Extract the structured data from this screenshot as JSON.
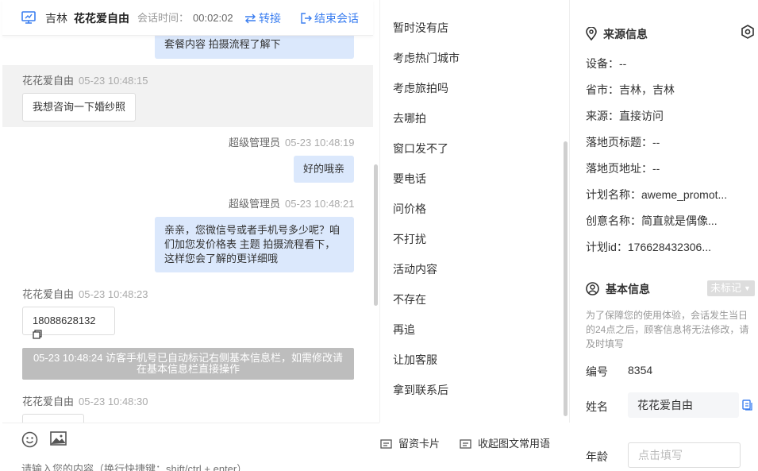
{
  "header": {
    "city": "吉林",
    "customer_name": "花花爱自由",
    "session_time_label": "会话时间：",
    "session_time": "00:02:02",
    "transfer_label": "转接",
    "end_label": "结束会话"
  },
  "messages": {
    "m0": {
      "text": "套餐内容 拍摄流程了解下"
    },
    "m1": {
      "sender": "花花爱自由",
      "time": "05-23 10:48:15",
      "text": "我想咨询一下婚纱照"
    },
    "m2": {
      "sender": "超级管理员",
      "time": "05-23 10:48:19",
      "text": "好的哦亲"
    },
    "m3": {
      "sender": "超级管理员",
      "time": "05-23 10:48:21",
      "line1": "亲亲，您微信号或者手机号多少呢？咱",
      "line2": "们加您发价格表 主题 拍摄流程看下，",
      "line3": "这样您会了解的更详细哦"
    },
    "m4": {
      "sender": "花花爱自由",
      "time": "05-23 10:48:23",
      "text": "18088628132"
    },
    "system": {
      "line1": "05-23 10:48:24 访客手机号已自动标记右侧基本信息栏，如需修改请",
      "line2": "在基本信息栏直接操作"
    },
    "m5": {
      "sender": "花花爱自由",
      "time": "05-23 10:48:30"
    }
  },
  "composer": {
    "card_label": "留资卡片",
    "phrases_label": "收起图文常用语",
    "placeholder": "请输入您的内容（换行快捷键：shift/ctrl + enter）"
  },
  "quick_replies": [
    "暂时没有店",
    "考虑热门城市",
    "考虑旅拍吗",
    "去哪拍",
    "窗口发不了",
    "要电话",
    "问价格",
    "不打扰",
    "活动内容",
    "不存在",
    "再追",
    "让加客服",
    "拿到联系后"
  ],
  "source_info": {
    "title": "来源信息",
    "device": "设备：--",
    "province_city": "省市：吉林，吉林",
    "source": "来源：直接访问",
    "landing_title": "落地页标题：--",
    "landing_url": "落地页地址：--",
    "plan_name": "计划名称：aweme_promot...",
    "creative_name": "创意名称：简直就是偶像...",
    "plan_id": "计划id：176628432306..."
  },
  "basic_info": {
    "title": "基本信息",
    "tag": "未标记",
    "note": "为了保障您的使用体验，会话发生当日的24点之后，顾客信息将无法修改，请及时填写",
    "number_label": "编号",
    "number": "8354",
    "name_label": "姓名",
    "name": "花花爱自由",
    "age_label": "年龄",
    "age_placeholder": "点击填写"
  },
  "colors": {
    "accent": "#3a7ef0",
    "bubble_me": "#dbe8fc",
    "system_note": "#bdbdbd"
  }
}
